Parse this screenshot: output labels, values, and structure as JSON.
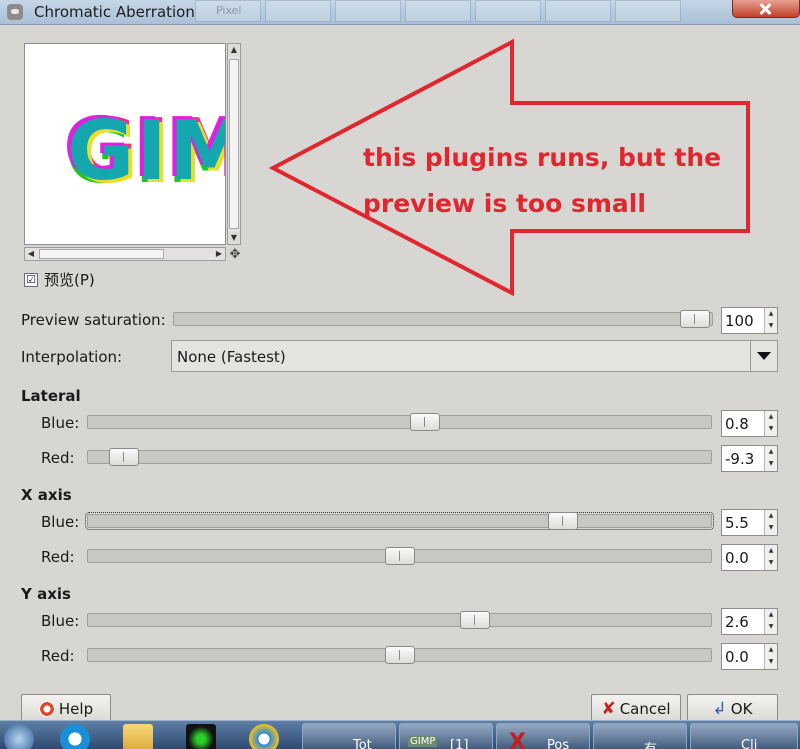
{
  "window": {
    "title": "Chromatic Aberration",
    "close_icon": "close-icon",
    "background_tabs": [
      "Pixel",
      "",
      "",
      "",
      "",
      "",
      "",
      ""
    ]
  },
  "preview": {
    "image_text": "GIMP",
    "checkbox_checked": true,
    "checkbox_mark": "☑",
    "checkbox_label": "预览(P)"
  },
  "annotation": {
    "line1": "this plugins runs, but the",
    "line2": "preview is too small",
    "color": "#e0262e"
  },
  "preview_saturation": {
    "label": "Preview saturation:",
    "value": "100",
    "slider_fraction": 1.0
  },
  "interpolation": {
    "label": "Interpolation:",
    "value": "None (Fastest)"
  },
  "lateral": {
    "title": "Lateral",
    "blue": {
      "label": "Blue:",
      "value": "0.8"
    },
    "red": {
      "label": "Red:",
      "value": "-9.3"
    }
  },
  "x_axis": {
    "title": "X axis",
    "blue": {
      "label": "Blue:",
      "value": "5.5"
    },
    "red": {
      "label": "Red:",
      "value": "0.0"
    }
  },
  "y_axis": {
    "title": "Y axis",
    "blue": {
      "label": "Blue:",
      "value": "2.6"
    },
    "red": {
      "label": "Red:",
      "value": "0.0"
    }
  },
  "buttons": {
    "help": "Help",
    "cancel": "Cancel",
    "ok": "OK"
  },
  "taskbar": {
    "items": [
      {
        "text": "Tot"
      },
      {
        "text": "[1]",
        "badge": "GIMP"
      },
      {
        "text": "Pos"
      },
      {
        "text": "有"
      },
      {
        "text": "Cli"
      }
    ]
  }
}
